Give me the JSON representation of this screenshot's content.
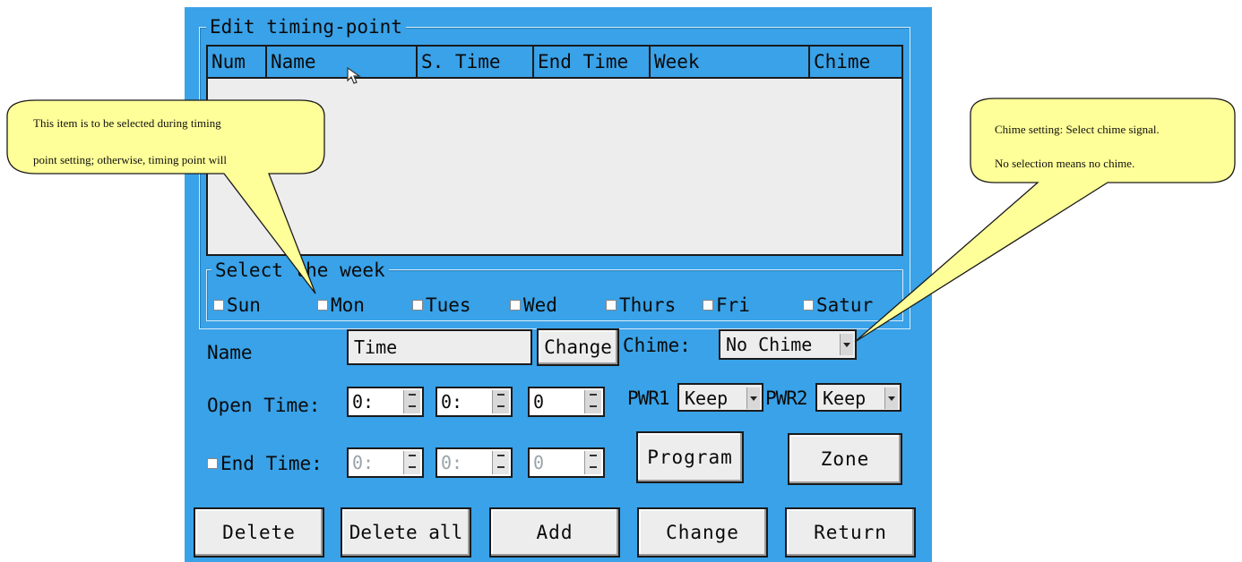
{
  "dialog": {
    "title": "Edit timing-point",
    "table": {
      "columns": [
        "Num",
        "Name",
        "S. Time",
        "End Time",
        "Week",
        "Chime"
      ],
      "rows": []
    },
    "week_group": {
      "title": "Select the week",
      "days": [
        "Sun",
        "Mon",
        "Tues",
        "Wed",
        "Thurs",
        "Fri",
        "Satur"
      ]
    },
    "name": {
      "label": "Name",
      "value": "Time",
      "change_button": "Change"
    },
    "chime": {
      "label": "Chime:",
      "value": "No Chime"
    },
    "open_time": {
      "label": "Open Time:",
      "hour": "0:",
      "minute": "0:",
      "second": "0"
    },
    "pwr1": {
      "label": "PWR1",
      "value": "Keep"
    },
    "pwr2": {
      "label": "PWR2",
      "value": "Keep"
    },
    "end_time": {
      "label": "End Time:",
      "hour": "0:",
      "minute": "0:",
      "second": "0"
    },
    "program_button": "Program",
    "zone_button": "Zone",
    "bottom_buttons": {
      "delete": "Delete",
      "delete_all": "Delete all",
      "add": "Add",
      "change": "Change",
      "return": "Return"
    }
  },
  "callouts": {
    "left": [
      "This item is to be selected during timing",
      "point setting; otherwise, timing point will"
    ],
    "right": [
      "Chime setting: Select chime signal.",
      "No selection means no chime."
    ]
  },
  "colors": {
    "panel": "#39a2e8",
    "field": "#ededed",
    "callout": "#ffff99"
  }
}
